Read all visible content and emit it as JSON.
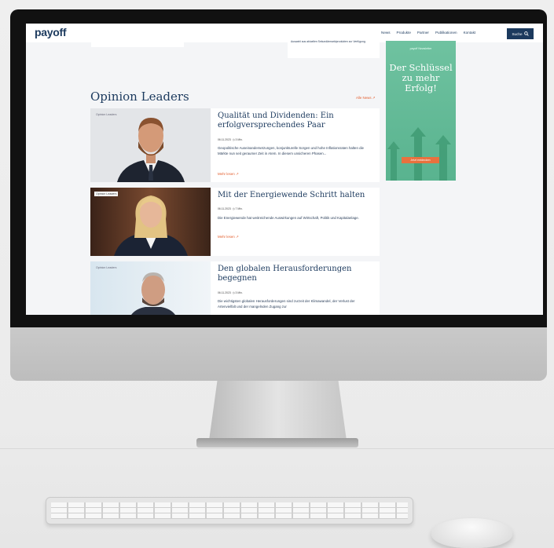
{
  "site": {
    "logo": "payoff",
    "nav": [
      "News",
      "Produkte",
      "Partner",
      "Publikationen",
      "Kontakt"
    ],
    "search_label": "Suche",
    "search_icon": "magnifier-icon"
  },
  "top_card_text": "Auswahl aus aktuellen Sekundärmarktprodukten zur Verfügung.",
  "section": {
    "title": "Opinion Leaders",
    "all_news": "Alle News"
  },
  "articles": [
    {
      "badge": "Opinion Leaders",
      "title": "Qualität und Dividenden: Ein erfolgversprechendes Paar",
      "date": "06.11.2023",
      "read_time": "3 Min.",
      "excerpt": "Geopolitische Auseinandersetzungen, konjunkturelle Sorgen und hohe Inflationsraten halten die Märkte nun seit geraumer Zeit in Atem. In diesem unsicheren Phasen...",
      "more": "Mehr lesen"
    },
    {
      "badge": "Opinion Leaders",
      "title": "Mit der Energiewende Schritt halten",
      "date": "06.11.2023",
      "read_time": "7 Min.",
      "excerpt": "Die Energiewende hat weitreichende Auswirkungen auf Wirtschaft, Politik und Kapitalanlage.",
      "more": "Mehr lesen"
    },
    {
      "badge": "Opinion Leaders",
      "title": "Den globalen Herausforderungen begegnen",
      "date": "06.11.2023",
      "read_time": "3 Min.",
      "excerpt": "Die wichtigsten globalen Herausforderungen sind zurzeit der Klimawandel, der Verlust der Artenvielfalt und der mangelnden Zugang zur",
      "more": ""
    }
  ],
  "ad": {
    "brand": "payoff Newsletter",
    "headline": "Der Schlüssel zu mehr Erfolg!",
    "button": "Jetzt entdecken"
  },
  "colors": {
    "brand": "#1c3a5e",
    "accent": "#e35d2c",
    "ad_green": "#6fc2a0",
    "ad_button": "#e8713e"
  }
}
